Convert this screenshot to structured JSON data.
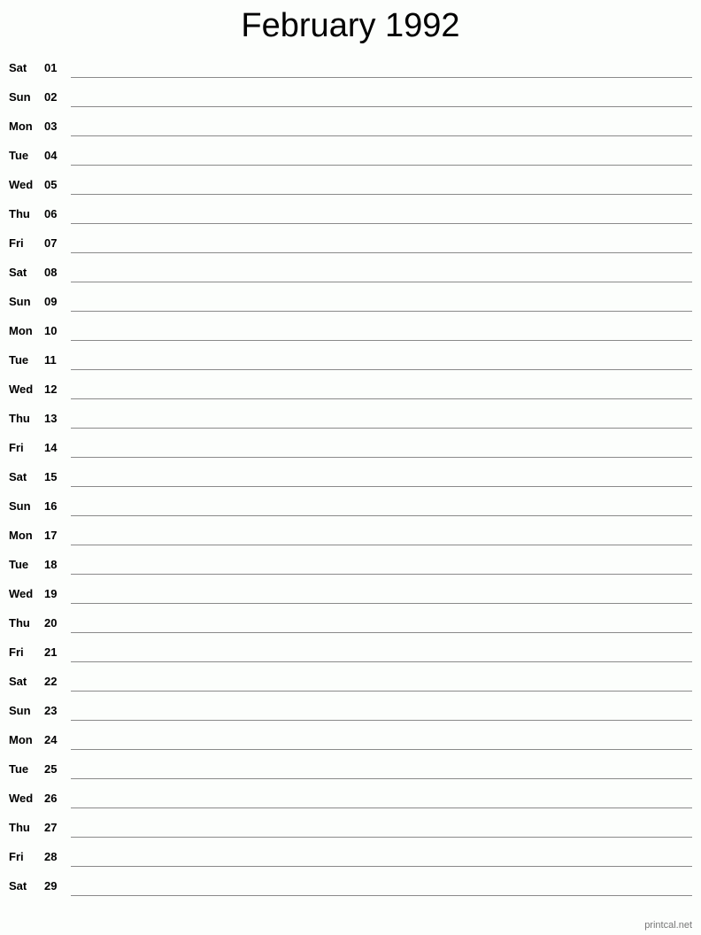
{
  "title": "February 1992",
  "days": [
    {
      "dow": "Sat",
      "num": "01"
    },
    {
      "dow": "Sun",
      "num": "02"
    },
    {
      "dow": "Mon",
      "num": "03"
    },
    {
      "dow": "Tue",
      "num": "04"
    },
    {
      "dow": "Wed",
      "num": "05"
    },
    {
      "dow": "Thu",
      "num": "06"
    },
    {
      "dow": "Fri",
      "num": "07"
    },
    {
      "dow": "Sat",
      "num": "08"
    },
    {
      "dow": "Sun",
      "num": "09"
    },
    {
      "dow": "Mon",
      "num": "10"
    },
    {
      "dow": "Tue",
      "num": "11"
    },
    {
      "dow": "Wed",
      "num": "12"
    },
    {
      "dow": "Thu",
      "num": "13"
    },
    {
      "dow": "Fri",
      "num": "14"
    },
    {
      "dow": "Sat",
      "num": "15"
    },
    {
      "dow": "Sun",
      "num": "16"
    },
    {
      "dow": "Mon",
      "num": "17"
    },
    {
      "dow": "Tue",
      "num": "18"
    },
    {
      "dow": "Wed",
      "num": "19"
    },
    {
      "dow": "Thu",
      "num": "20"
    },
    {
      "dow": "Fri",
      "num": "21"
    },
    {
      "dow": "Sat",
      "num": "22"
    },
    {
      "dow": "Sun",
      "num": "23"
    },
    {
      "dow": "Mon",
      "num": "24"
    },
    {
      "dow": "Tue",
      "num": "25"
    },
    {
      "dow": "Wed",
      "num": "26"
    },
    {
      "dow": "Thu",
      "num": "27"
    },
    {
      "dow": "Fri",
      "num": "28"
    },
    {
      "dow": "Sat",
      "num": "29"
    }
  ],
  "footer": "printcal.net"
}
